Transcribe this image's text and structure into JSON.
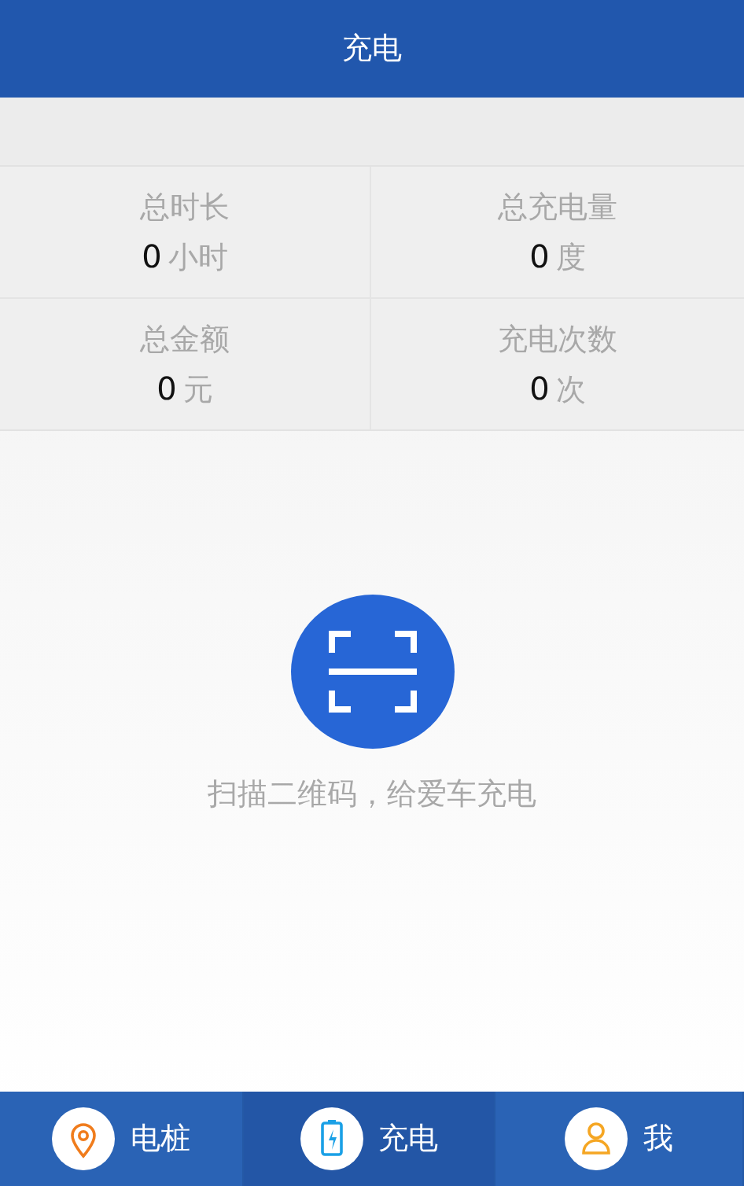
{
  "header": {
    "title": "充电"
  },
  "stats": [
    {
      "label": "总时长",
      "value": "0",
      "unit": "小时"
    },
    {
      "label": "总充电量",
      "value": "0",
      "unit": "度"
    },
    {
      "label": "总金额",
      "value": "0",
      "unit": "元"
    },
    {
      "label": "充电次数",
      "value": "0",
      "unit": "次"
    }
  ],
  "scan": {
    "caption": "扫描二维码，给爱车充电"
  },
  "tabs": [
    {
      "label": "电桩",
      "kind": "pin",
      "selected": false
    },
    {
      "label": "充电",
      "kind": "battery",
      "selected": true
    },
    {
      "label": "我",
      "kind": "person",
      "selected": false
    }
  ]
}
